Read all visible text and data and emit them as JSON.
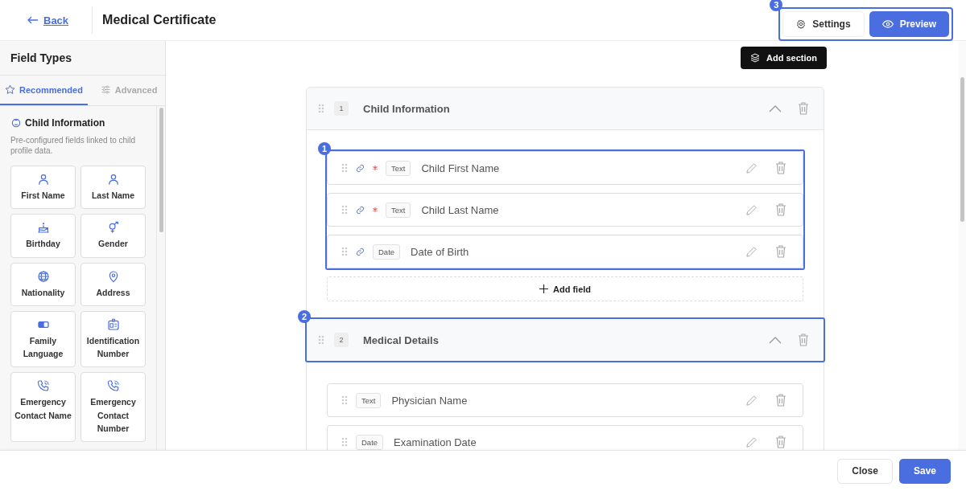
{
  "header": {
    "back_label": "Back",
    "title": "Medical Certificate",
    "actions_callout": "3",
    "settings_label": "Settings",
    "preview_label": "Preview"
  },
  "sidebar": {
    "title": "Field Types",
    "tabs": [
      {
        "label": "Recommended",
        "kind": "star",
        "selected": true
      },
      {
        "label": "Advanced",
        "kind": "sliders",
        "selected": false
      }
    ],
    "group": {
      "title": "Child Information",
      "description": "Pre-configured fields linked to child profile data.",
      "items": [
        {
          "label": "First Name",
          "kind": "person"
        },
        {
          "label": "Last Name",
          "kind": "person"
        },
        {
          "label": "Birthday",
          "kind": "cake"
        },
        {
          "label": "Gender",
          "kind": "gender"
        },
        {
          "label": "Nationality",
          "kind": "globe"
        },
        {
          "label": "Address",
          "kind": "pin"
        },
        {
          "label": "Family Language",
          "kind": "lang"
        },
        {
          "label": "Identification Number",
          "kind": "badge"
        },
        {
          "label": "Emergency Contact Name",
          "kind": "phone"
        },
        {
          "label": "Emergency Contact Number",
          "kind": "phone"
        }
      ]
    }
  },
  "canvas": {
    "add_section_label": "Add section",
    "sections": [
      {
        "number": "1",
        "title": "Child Information",
        "fields_callout": "1",
        "add_field_label": "Add field",
        "fields": [
          {
            "type": "Text",
            "name": "Child First Name",
            "linked": true,
            "required": true
          },
          {
            "type": "Text",
            "name": "Child Last Name",
            "linked": true,
            "required": true
          },
          {
            "type": "Date",
            "name": "Date of Birth",
            "linked": true,
            "required": false
          }
        ]
      },
      {
        "number": "2",
        "title": "Medical Details",
        "header_callout": "2",
        "fields": [
          {
            "type": "Text",
            "name": "Physician Name",
            "linked": false,
            "required": false
          },
          {
            "type": "Date",
            "name": "Examination Date",
            "linked": false,
            "required": false
          }
        ]
      }
    ]
  },
  "footer": {
    "close_label": "Close",
    "save_label": "Save"
  }
}
